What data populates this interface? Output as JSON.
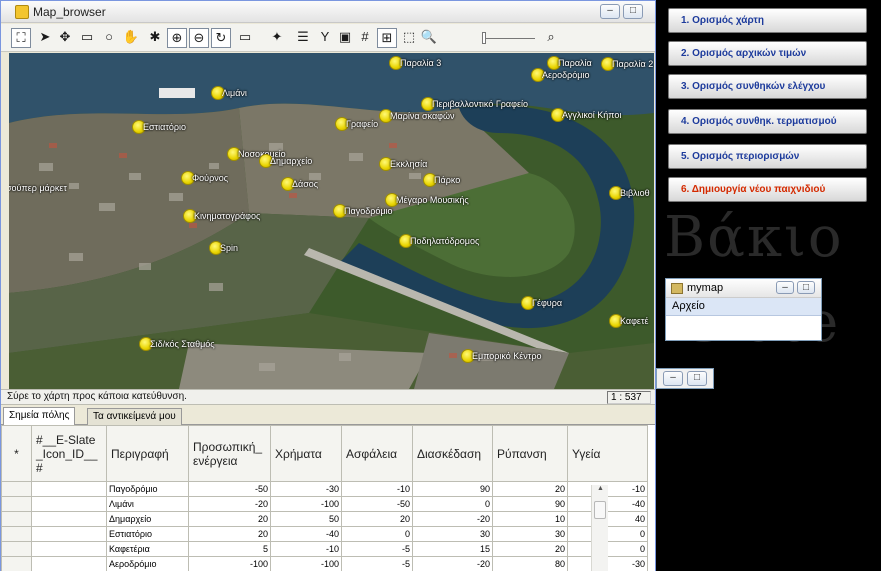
{
  "window": {
    "title": "Map_browser"
  },
  "toolbar": {
    "icons": [
      "select-icon",
      "pointer-icon",
      "pan-icon",
      "rect-select-icon",
      "ellipse-select-icon",
      "grab-icon",
      "pin-icon",
      "zoom-in-icon",
      "zoom-out-icon",
      "refresh-icon",
      "ruler-icon",
      "star-pointer-icon",
      "layers-icon",
      "filter-icon",
      "image-icon",
      "grid-icon",
      "center-icon",
      "zoom-window-icon",
      "zoom-slider-icon",
      "magnifier-icon"
    ]
  },
  "map": {
    "markers": [
      {
        "label": "Παραλία 3"
      },
      {
        "label": "Παραλία"
      },
      {
        "label": "Παραλία 2"
      },
      {
        "label": "Αεροδρόμιο"
      },
      {
        "label": "Λιμάνι"
      },
      {
        "label": "Περιβαλλοντικό Γραφείο"
      },
      {
        "label": "Αγγλικοί Κήποι"
      },
      {
        "label": "Εστιατόριο"
      },
      {
        "label": "Γραφείο"
      },
      {
        "label": "Μαρίνα σκαφών"
      },
      {
        "label": "Νοσοκομείο"
      },
      {
        "label": "Δημαρχείο"
      },
      {
        "label": "Εκκλησία"
      },
      {
        "label": "Πάρκο"
      },
      {
        "label": "Φούρνος"
      },
      {
        "label": "Δάσος"
      },
      {
        "label": "σούπερ μάρκετ"
      },
      {
        "label": "Μέγαρο Μουσικής"
      },
      {
        "label": "Βιβλιοθ"
      },
      {
        "label": "Παγοδρόμιο"
      },
      {
        "label": "Κινηματογράφος"
      },
      {
        "label": "Ποδηλατόδρομος"
      },
      {
        "label": "Spin"
      },
      {
        "label": "Γέφυρα"
      },
      {
        "label": "Καφετέ"
      },
      {
        "label": "Σιδ/κός Σταθμός"
      },
      {
        "label": "Εμπορικό Κέντρο"
      }
    ]
  },
  "status": {
    "text": "Σύρε το χάρτη προς κάποια κατεύθυνση.",
    "scale": "1 : 537"
  },
  "tabs": [
    {
      "label": "Σημεία πόλης",
      "active": true
    },
    {
      "label": "Τα αντικείμενά μου",
      "active": false
    }
  ],
  "grid": {
    "row_marker": "*",
    "columns": [
      "#__E-Slate_Icon_ID__#",
      "Περιγραφή",
      "Προσωπική_ενέργεια",
      "Χρήματα",
      "Ασφάλεια",
      "Διασκέδαση",
      "Ρύπανση",
      "Υγεία"
    ],
    "rows": [
      [
        "",
        "Παγοδρόμιο",
        "-50",
        "-30",
        "-10",
        "90",
        "20",
        "-10"
      ],
      [
        "",
        "Λιμάνι",
        "-20",
        "-100",
        "-50",
        "0",
        "90",
        "-40"
      ],
      [
        "",
        "Δημαρχείο",
        "20",
        "50",
        "20",
        "-20",
        "10",
        "40"
      ],
      [
        "",
        "Εστιατόριο",
        "20",
        "-40",
        "0",
        "30",
        "30",
        "0"
      ],
      [
        "",
        "Καφετέρια",
        "5",
        "-10",
        "-5",
        "15",
        "20",
        "0"
      ],
      [
        "",
        "Αεροδρόμιο",
        "-100",
        "-100",
        "-5",
        "-20",
        "80",
        "-30"
      ]
    ]
  },
  "side_menu": {
    "items": [
      {
        "label": "1. Ορισμός χάρτη",
        "color": "#1d3b9c"
      },
      {
        "label": "2. Ορισμός αρχικών τιμών",
        "color": "#1d3b9c"
      },
      {
        "label": "3. Ορισμός συνθηκών ελέγχου",
        "color": "#1d3b9c"
      },
      {
        "label": "4. Ορισμός συνθηκ. τερματισμού",
        "color": "#1d3b9c"
      },
      {
        "label": "5. Ορισμός περιορισμών",
        "color": "#1d3b9c"
      },
      {
        "label": "6. Δημιουργία νέου παιχνιδιού",
        "color": "#d42a00"
      }
    ],
    "bg_text_1": "Βάκιο",
    "bg_text_2": "-Slate"
  },
  "mymap": {
    "title": "mymap",
    "menu": "Αρχείο"
  }
}
